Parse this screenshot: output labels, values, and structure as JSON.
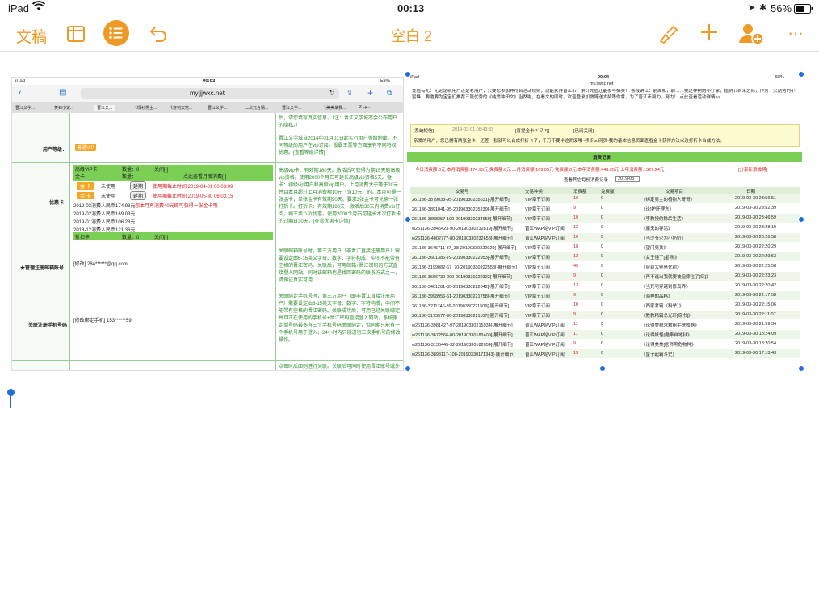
{
  "status": {
    "device": "iPad",
    "time": "00:13",
    "battery": "56%"
  },
  "toolbar": {
    "back_label": "文稿",
    "title": "空白 2",
    "colors": {
      "accent": "#ee9a26"
    }
  },
  "shot1": {
    "status": {
      "device": "iPad",
      "time": "00:03",
      "battery": "58%"
    },
    "url": "my.jjwxc.net",
    "tabs": [
      "晋江文学...",
      "黄锦小说...",
      "晋江文...",
      "《绿衫男主...",
      "《穿到大佬...",
      "晋江文学...",
      "二次元言情...",
      "晋江文学...",
      "《美美掌我...",
      "2 cp..."
    ],
    "rows": [
      {
        "label": "",
        "left": "",
        "right": "后，请您填写真实信息。（注：晋江文学城不会公布用户的隐私。）"
      },
      {
        "label": "用户等级：",
        "left": "普通VIP",
        "right": "晋江文学城自2014年01月01日起实行用户等级制度。不同等级的用户在vip订阅、投霸王票等方面享有不同特权优惠。[查看等级详情]"
      },
      {
        "label": "优惠卡：",
        "right": "高级vip卡：有效期180天。激活后可获得为期15天的高级vip资格。使用2000个月石可延长高级vip资格5天。金卡：初级vip用户和高级vip用户，上月消费大于等于20元并且本月超过上月消费额10元（含10元）的，本月可得一张金卡，单张金卡有效期90天。要求3张金卡可兑换一张打折卡。打折卡：有效期180天，激活后30天内消费vip订阅，霸王票八折优惠。使用2000个月石可延长本次打折卡的过期日30天。[查看优惠卡详情]"
      },
      {
        "label": "★管理注册邮箱账号：",
        "left": "[修改] 284******@qq.com",
        "right": "关联邮箱账号时，第三方用户（非晋江直接注册用户）需要设定由6-15英文字母、数字、字符构成，中间不能带有空格的晋江密码。关联后，可用邮箱+晋江密码的方式直接登入网站。同时该邮箱也是找回密码的联系方式之一，请保证真实可用"
      },
      {
        "label": "关联注册手机号码",
        "left": "[修改绑定手机] 153******59",
        "right": "关联绑定手机号时，第三方用户（即非晋江直接注册用户）需要设定由6-15英文字母、数字、字符构成，中间不能带有空格的晋江密码。关联成功后，可用已经关联绑定并且正在使用的手机号+晋江密码直接登入网站。系统限定单号码最多有三个手机号码关联绑定，但同期只能有一个手机号用于登入，24小时内只能进行三次手机号的修改操作。"
      },
      {
        "label": "",
        "left": "",
        "right": "点击时后面则进行关联。关联后可同时使用晋江账号或外"
      }
    ],
    "cards": {
      "header": [
        "高级VIP卡",
        "数量：0",
        "关闭[-]"
      ],
      "gold": [
        "金卡",
        "数量：",
        "点此查看月度消费[-]"
      ],
      "items": [
        [
          "金 卡",
          "未使用",
          "延期",
          "使用期截止时间:2019-04-01 06:03:09"
        ],
        [
          "金 卡",
          "未使用",
          "延期",
          "使用期截止时间:2019-05-30 06:03:15"
        ]
      ],
      "months": [
        "2019-03消费人民币174.93元",
        "2019-02消费人民币169.03元",
        "2019-01消费人民币106.28元",
        "2018-12消费人民币121.36元"
      ],
      "notice": "您本月再消费40元即可获得一张金卡哦",
      "discount": [
        "折扣卡",
        "数量：0",
        "关闭[-]"
      ]
    }
  },
  "shot2": {
    "status": {
      "device": "iPad",
      "time": "00:04",
      "battery": "58%"
    },
    "url": "my.jjwxc.net",
    "intro": "充值有礼：无论是新用户还是老用户，只要您参加并符合活动规则，就能获得晋江币！累计充值还能参与抽奖！ 喜报讲江：前面和，前……挑是种树的小仔家，植树节到来之际，作为一只勤劳的小蜜蜂，要邀要为宝宝们推荐三篇优秀的《纯爱种田文》当然啦，在看文的同时，欢迎登录加微博送大奖等你拿，为了晋江币努力，努力！ 点此查看活动详情>>",
    "sys_label": "[系统短信]",
    "sys_date": "2019-03-01 06:43:33",
    "sys_title": "[喜提金卡(*´∇`*)]",
    "sys_close": "[已阅关闭]",
    "sys_msg": "亲爱的用户，您已拥有两张金卡，还差一张就可以合成打折卡了，千万不要半途而废哦~移步pc网页-我的基本信息页面查看金卡获得方法以及打折卡合成方法。",
    "panel_title": "消费记录",
    "summary": "今日消费额:0元 本月消费额:174.93元 免费额:0元 上月消费额:169.03元 免费额:0元 本年消费额:448.95元 上年消费额:1327.24元",
    "share": "[分享新浪微博]",
    "query_label": "查看其它月份消费记录",
    "query_value": "2019-03",
    "headers": [
      "交易号",
      "交易种类",
      "消费额",
      "免费额",
      "交易项目",
      "日期"
    ],
    "records": [
      [
        "261136-3879038-95-20190330235631[-展开细节]",
        "VIP章节订阅",
        "10",
        "0",
        "《绑定男主的植物人哥哥》",
        "2019-03-30 23:56:51"
      ],
      [
        "261136-3891041-95-20190330235239[-展开细节]",
        "VIP章节订阅",
        "9",
        "0",
        "《论]护肝理东》",
        "2019-03-30 23:52:39"
      ],
      [
        "261136-3868257-100-20190330234659[-展开细节]",
        "VIP章节订阅",
        "10",
        "0",
        "《李教授的稳后生活》",
        "2019-03-30 23:46:59"
      ],
      [
        "w261136-3945423-90-20190330232819[-展开细节]",
        "晋江WAP站VIP订阅",
        "12",
        "0",
        "《魔鬼的存活》",
        "2019-03-30 23:28:19"
      ],
      [
        "w261136-4002777-80-20190330232658[-展开细节]",
        "晋江WAP站VIP订阅",
        "10",
        "0",
        "《当少爷沦为小奶奶》",
        "2019-03-30 23:26:58"
      ],
      [
        "261136-3645711-37_38-20190330222029[-展开细节]",
        "VIP章节订阅",
        "18",
        "0",
        "《望门男孩》",
        "2019-03-30 22:20:29"
      ],
      [
        "261136-3601386-79-20190330222953[-展开细节]",
        "VIP章节订阅",
        "12",
        "0",
        "《女王懂了[星际]》",
        "2019-03-30 22:29:53"
      ],
      [
        "261136-3199082-67_70-20190330222558[-展开细节]",
        "VIP章节订阅",
        "45",
        "0",
        "《穿到大佬黑化前》",
        "2019-03-30 22:25:58"
      ],
      [
        "261136-3666739-209-20190330222323[-展开细节]",
        "VIP章节订阅",
        "9",
        "0",
        "《再不逃出我就要被迫嫁位了[综]》",
        "2019-03-30 22:23:23"
      ],
      [
        "261136-3461281-65-20190330222042[-展开细节]",
        "VIP章节订阅",
        "13",
        "0",
        "《当死宅穿越到修真界》",
        "2019-03-30 22:20:42"
      ],
      [
        "261136-3998956-61-20190330221758[-展开细节]",
        "VIP章节订阅",
        "9",
        "0",
        "《海神的品格》",
        "2019-03-30 22:17:58"
      ],
      [
        "261136-3211746-89-20190330221506[-展开细节]",
        "VIP章节订阅",
        "10",
        "0",
        "《西家考霸（科举）》",
        "2019-03-30 22:15:06"
      ],
      [
        "261136-3173577-96-20190330221107[-展开细节]",
        "VIP章节订阅",
        "9",
        "0",
        "《教教精霸总光环[穿书]》",
        "2019-03-30 22:11:07"
      ],
      [
        "w261136-3981427-97-20190330215934[-展开细节]",
        "晋江WAP站VIP订阅",
        "11",
        "0",
        "《论得美貌求救组手撩收器》",
        "2019-03-30 21:59:34"
      ],
      [
        "w261136-3672566-00-20190330182409[-展开细节]",
        "晋江WAP站VIP订阅",
        "11",
        "0",
        "《论得妖怪(酷奉自地狱》",
        "2019-03-30 18:24:09"
      ],
      [
        "w261136-3136445-32-20190330182054[-展开细节]",
        "晋江WAP站VIP订阅",
        "9",
        "0",
        "《论得美美[医师黑危物种》",
        "2019-03-30 18:20:54"
      ],
      [
        "w261136-3898117-108-20190330171343[-展开细节]",
        "晋江WAP站VIP订阅",
        "13",
        "0",
        "《皇子起霸斗史》",
        "2019-03-30 17:13:43"
      ]
    ]
  }
}
